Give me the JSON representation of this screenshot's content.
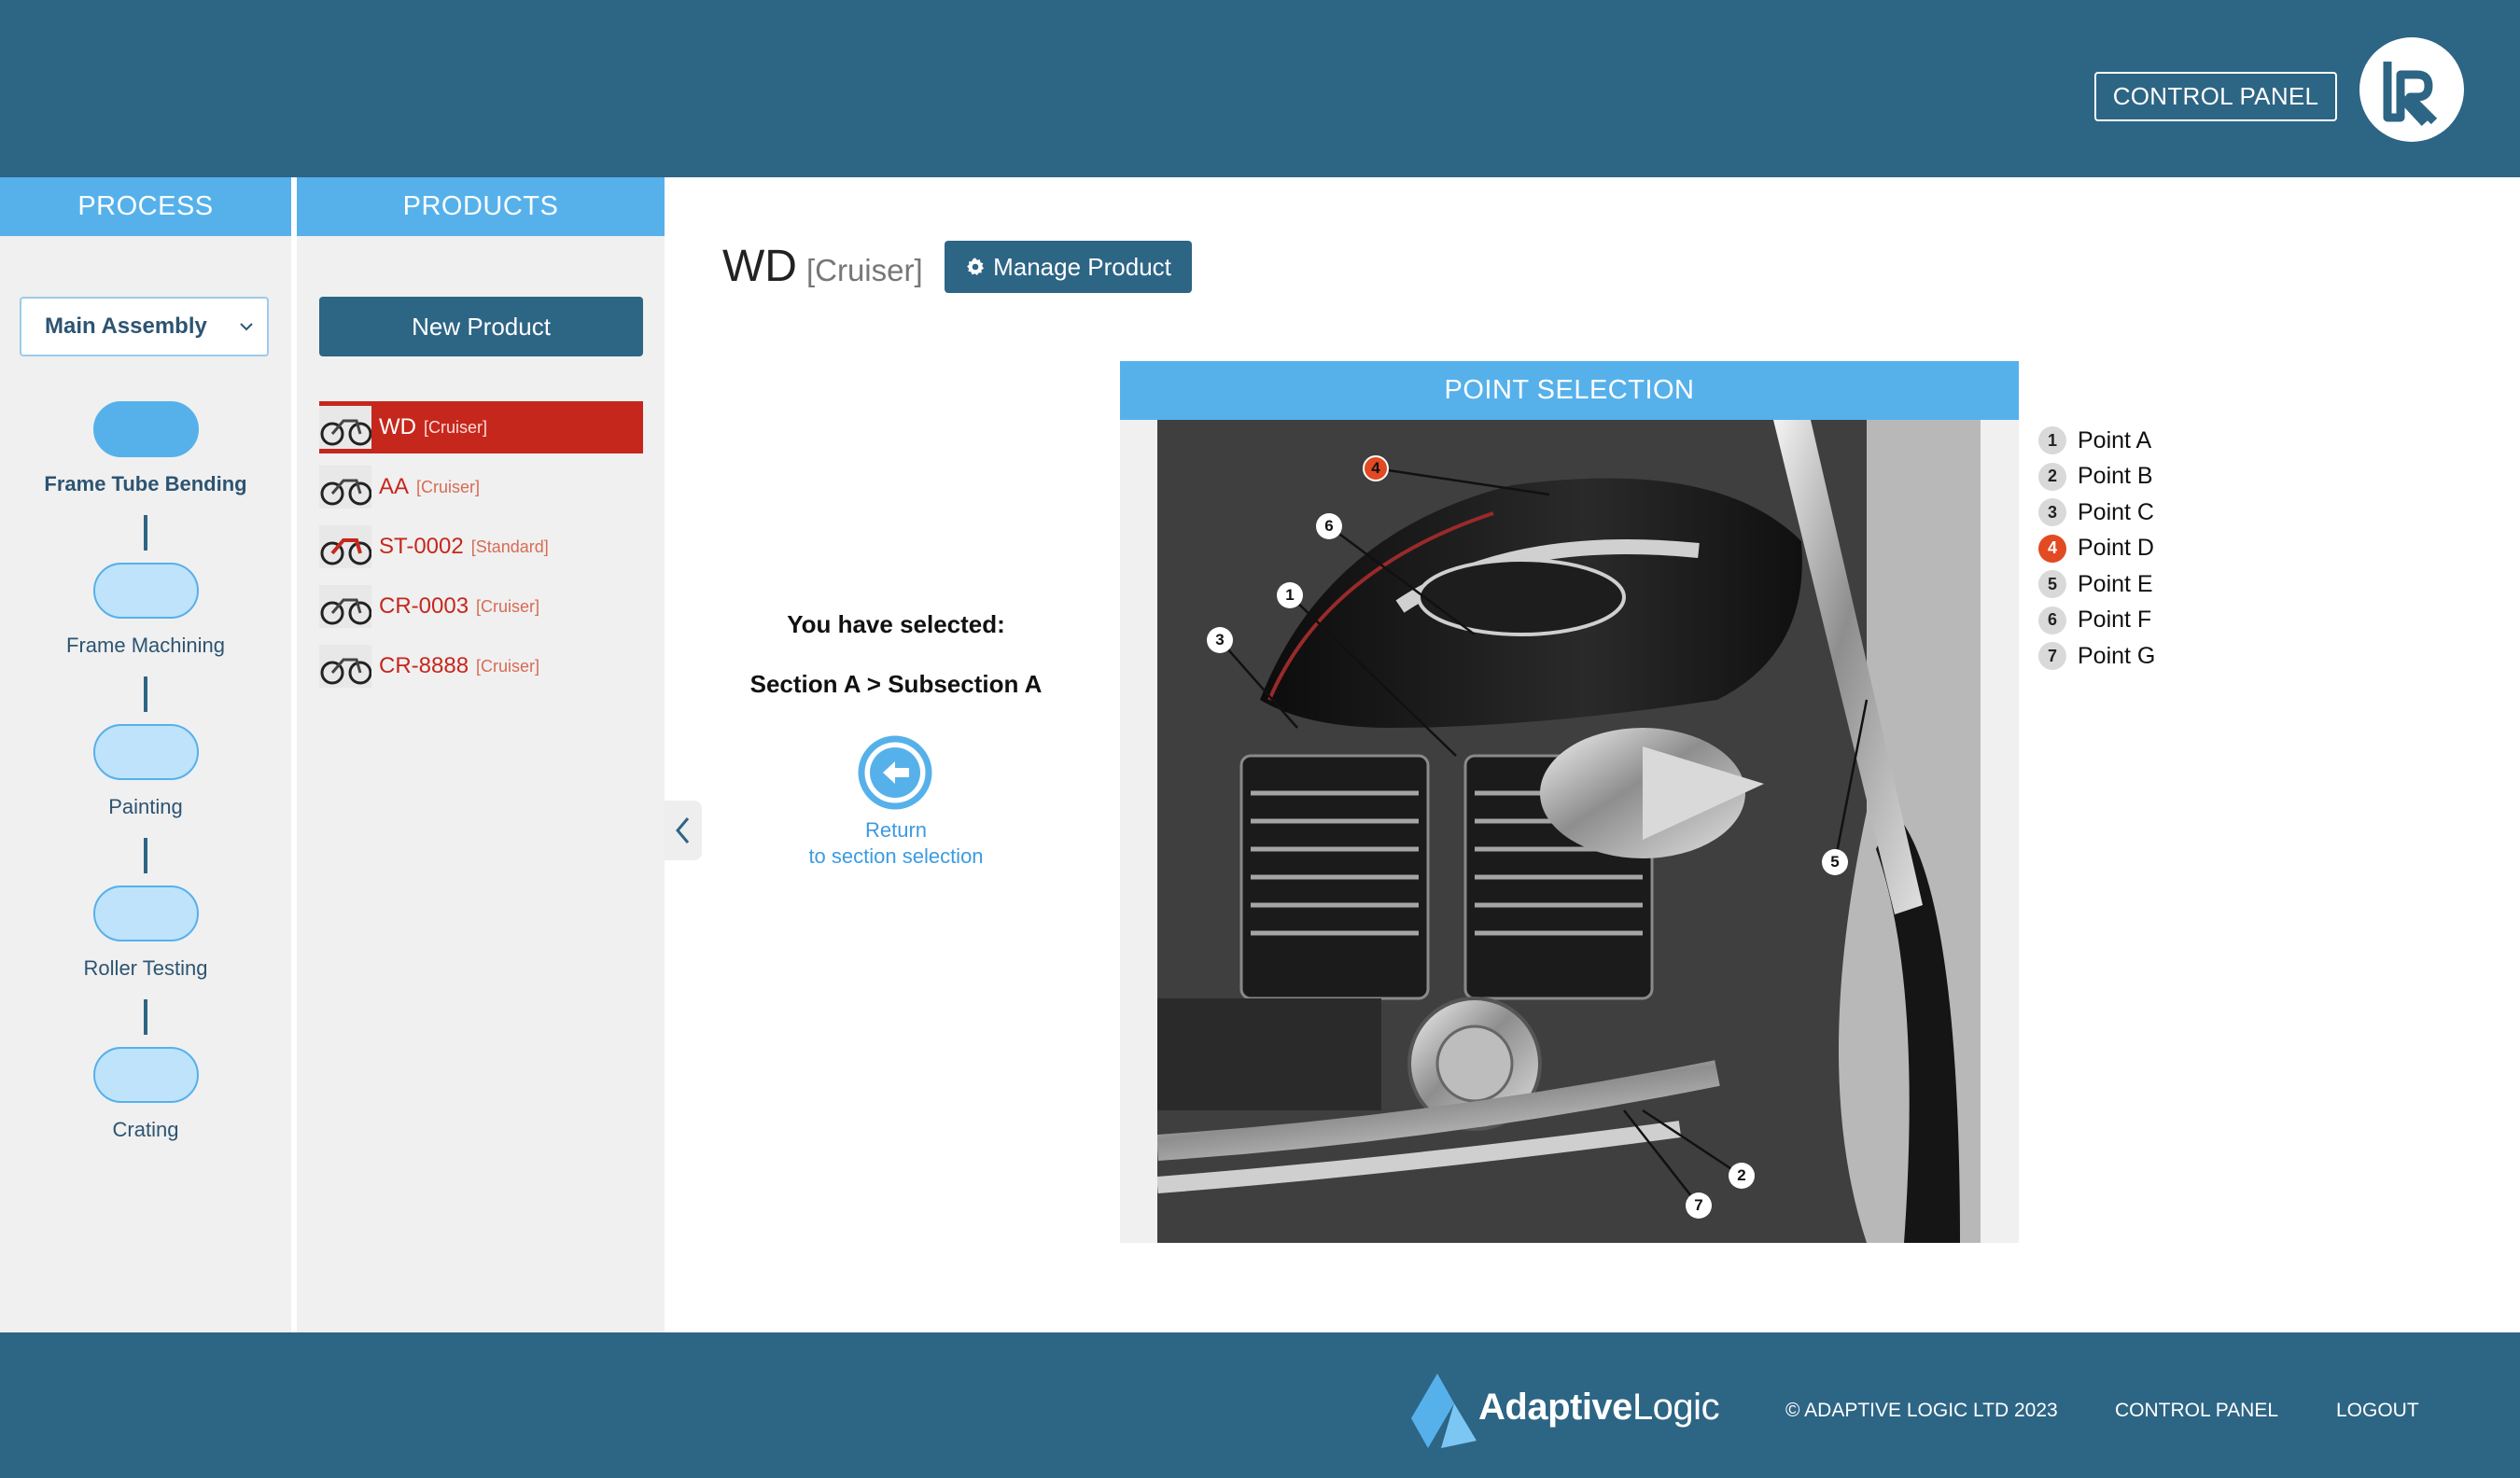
{
  "header": {
    "control_panel_label": "CONTROL PANEL"
  },
  "process": {
    "heading": "PROCESS",
    "assembly_value": "Main Assembly",
    "steps": [
      {
        "label": "Frame Tube Bending"
      },
      {
        "label": "Frame Machining"
      },
      {
        "label": "Painting"
      },
      {
        "label": "Roller Testing"
      },
      {
        "label": "Crating"
      }
    ]
  },
  "products": {
    "heading": "PRODUCTS",
    "new_label": "New Product",
    "items": [
      {
        "name": "WD",
        "type": "[Cruiser]"
      },
      {
        "name": "AA",
        "type": "[Cruiser]"
      },
      {
        "name": "ST-0002",
        "type": "[Standard]"
      },
      {
        "name": "CR-0003",
        "type": "[Cruiser]"
      },
      {
        "name": "CR-8888",
        "type": "[Cruiser]"
      }
    ]
  },
  "main": {
    "title": "WD",
    "subtitle": "[Cruiser]",
    "manage_label": "Manage Product",
    "selected_heading": "You have selected:",
    "selected_path": "Section A > Subsection A",
    "return_line1": "Return",
    "return_line2": "to section selection"
  },
  "point_selection": {
    "heading": "POINT SELECTION",
    "points": [
      {
        "num": "1",
        "label": "Point A"
      },
      {
        "num": "2",
        "label": "Point B"
      },
      {
        "num": "3",
        "label": "Point C"
      },
      {
        "num": "4",
        "label": "Point D"
      },
      {
        "num": "5",
        "label": "Point E"
      },
      {
        "num": "6",
        "label": "Point F"
      },
      {
        "num": "7",
        "label": "Point G"
      }
    ],
    "image_markers": [
      "4",
      "6",
      "1",
      "3",
      "5",
      "2",
      "7"
    ]
  },
  "footer": {
    "brand_bold": "Adaptive",
    "brand_light": "Logic",
    "copyright": "© ADAPTIVE LOGIC LTD 2023",
    "control_panel": "CONTROL PANEL",
    "logout": "LOGOUT"
  },
  "colors": {
    "header_bg": "#2d6585",
    "accent_blue": "#56b1eb",
    "active_red": "#c6271d",
    "marker_active": "#e14a22"
  }
}
